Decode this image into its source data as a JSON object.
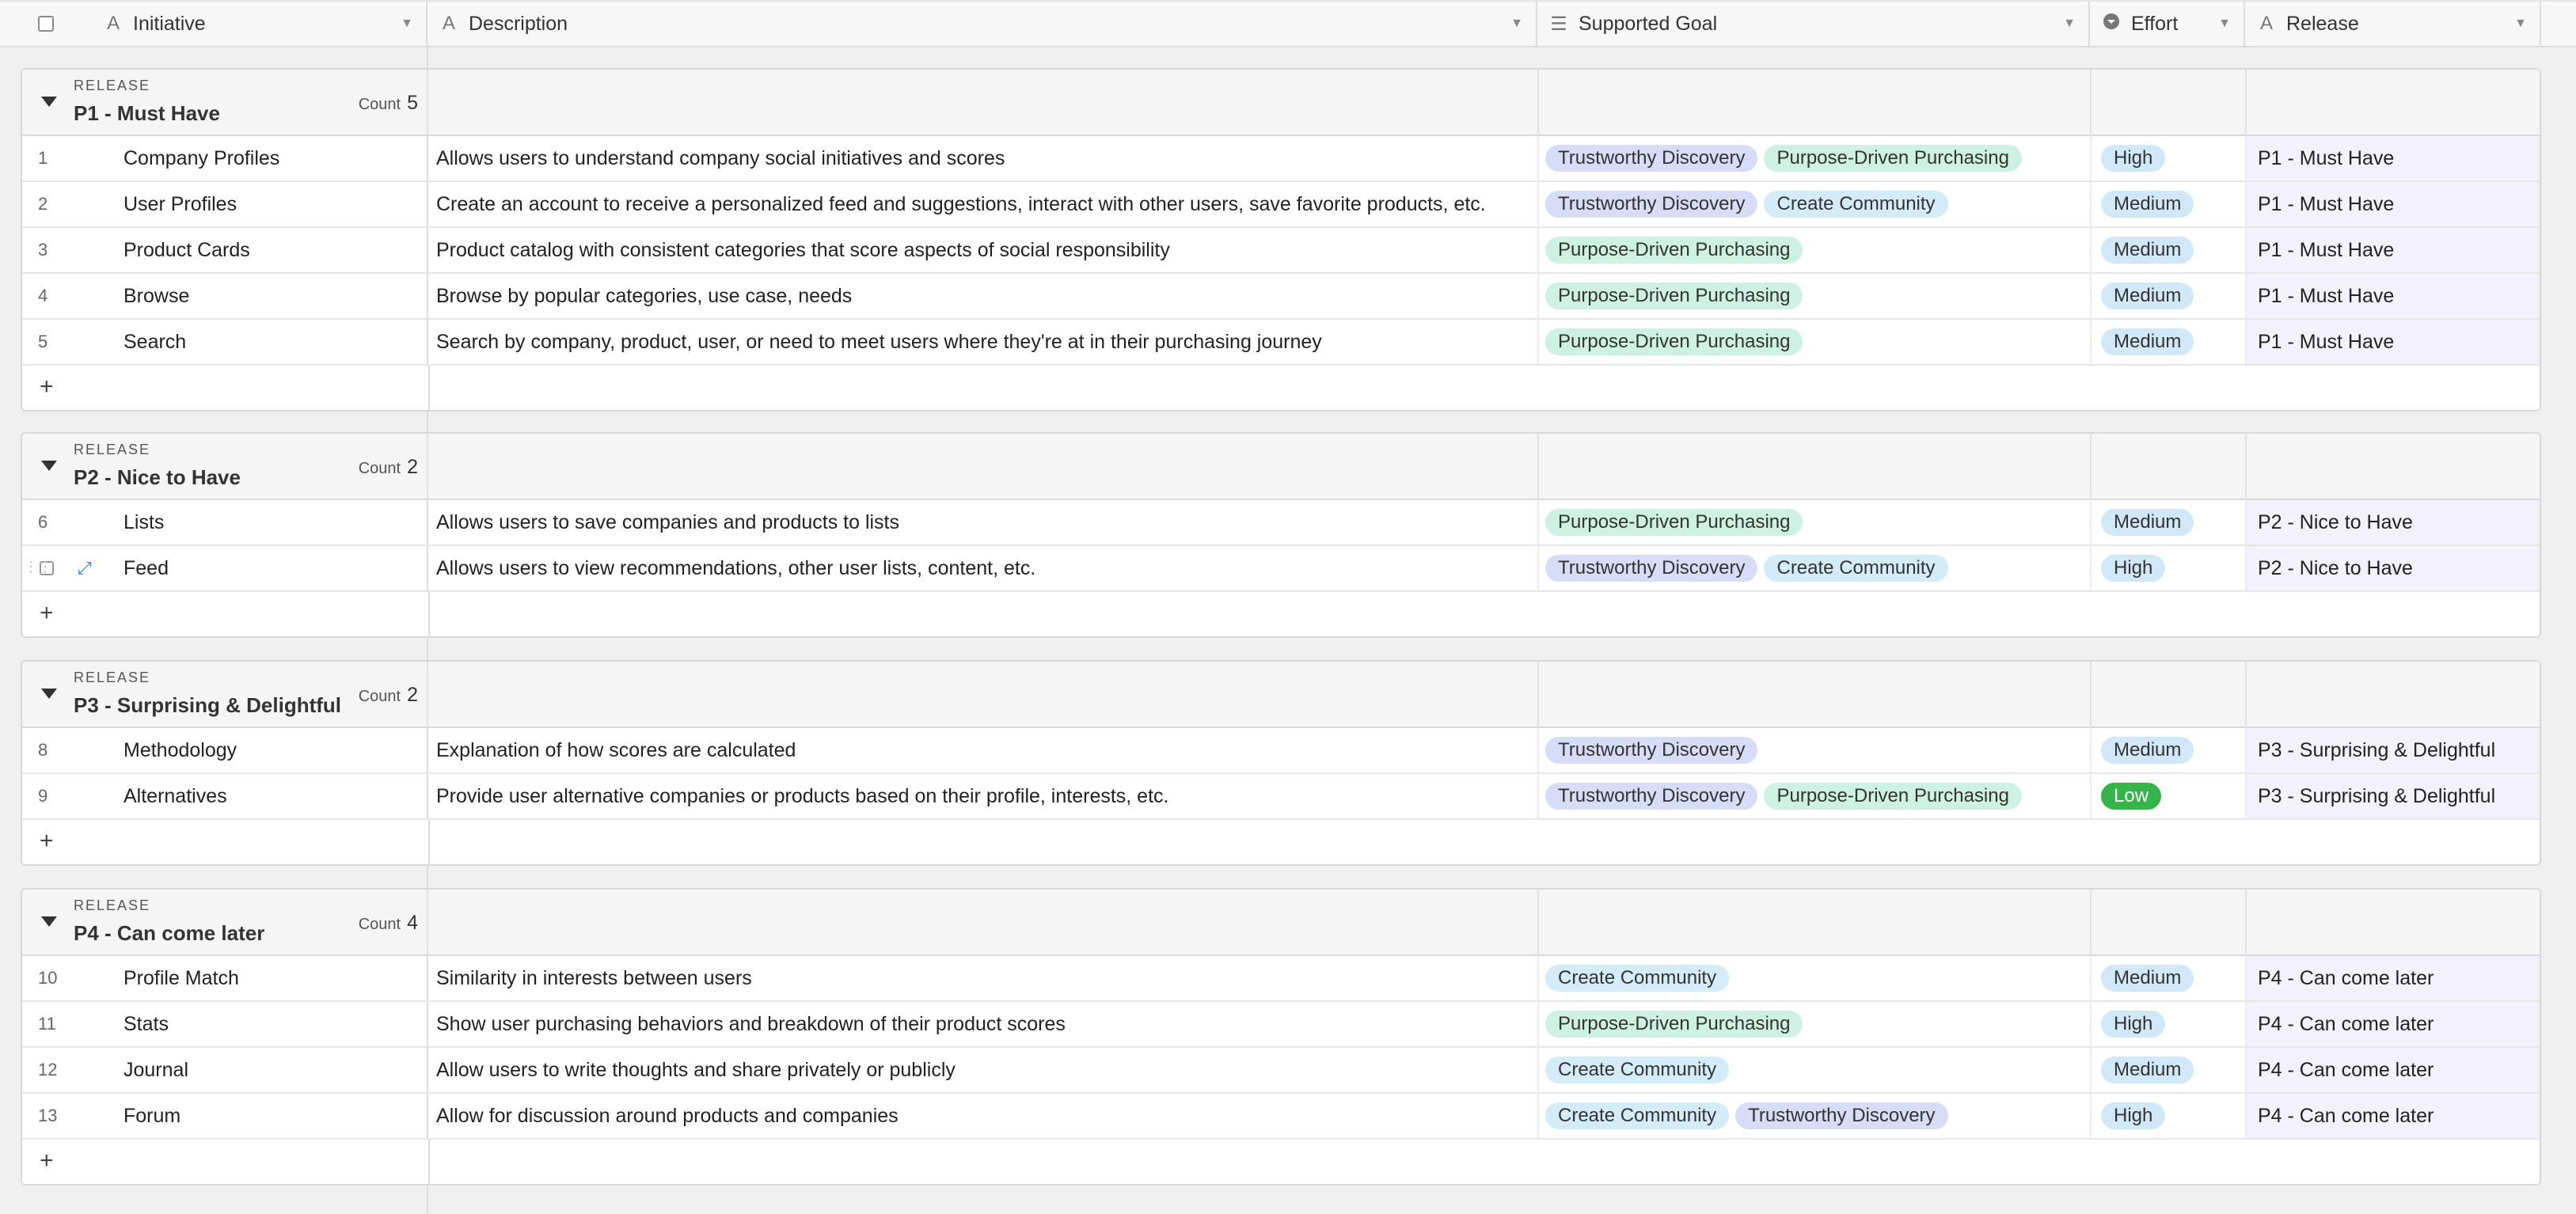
{
  "columns": {
    "initiative": {
      "label": "Initiative",
      "icon": "A"
    },
    "description": {
      "label": "Description",
      "icon": "A"
    },
    "goal": {
      "label": "Supported Goal",
      "icon": "☰"
    },
    "effort": {
      "label": "Effort",
      "icon": "▾"
    },
    "release": {
      "label": "Release",
      "icon": "A"
    }
  },
  "group_label": "RELEASE",
  "count_label": "Count",
  "add_label": "+",
  "groups": [
    {
      "title": "P1 - Must Have",
      "count": "5",
      "rows": [
        {
          "num": "1",
          "initiative": "Company Profiles",
          "description": "Allows users to understand company social initiatives and scores",
          "goals": [
            "Trustworthy Discovery",
            "Purpose-Driven Purchasing"
          ],
          "effort": "High",
          "release": "P1 - Must Have"
        },
        {
          "num": "2",
          "initiative": "User Profiles",
          "description": "Create an account to receive a personalized feed and suggestions, interact with other users, save favorite products, etc.",
          "goals": [
            "Trustworthy Discovery",
            "Create Community"
          ],
          "effort": "Medium",
          "release": "P1 - Must Have"
        },
        {
          "num": "3",
          "initiative": "Product Cards",
          "description": "Product catalog with consistent categories that score aspects of social responsibility",
          "goals": [
            "Purpose-Driven Purchasing"
          ],
          "effort": "Medium",
          "release": "P1 - Must Have"
        },
        {
          "num": "4",
          "initiative": "Browse",
          "description": "Browse by popular categories, use case, needs",
          "goals": [
            "Purpose-Driven Purchasing"
          ],
          "effort": "Medium",
          "release": "P1 - Must Have"
        },
        {
          "num": "5",
          "initiative": "Search",
          "description": "Search by company, product, user, or need to meet users where they're at in their purchasing journey",
          "goals": [
            "Purpose-Driven Purchasing"
          ],
          "effort": "Medium",
          "release": "P1 - Must Have"
        }
      ]
    },
    {
      "title": "P2 - Nice to Have",
      "count": "2",
      "rows": [
        {
          "num": "6",
          "initiative": "Lists",
          "description": "Allows users to save companies and products to lists",
          "goals": [
            "Purpose-Driven Purchasing"
          ],
          "effort": "Medium",
          "release": "P2 - Nice to Have"
        },
        {
          "num": "",
          "initiative": "Feed",
          "description": "Allows users to view recommendations, other user lists, content, etc.",
          "goals": [
            "Trustworthy Discovery",
            "Create Community"
          ],
          "effort": "High",
          "release": "P2 - Nice to Have",
          "hover": true
        }
      ]
    },
    {
      "title": "P3 - Surprising & Delightful",
      "count": "2",
      "rows": [
        {
          "num": "8",
          "initiative": "Methodology",
          "description": "Explanation of how scores are calculated",
          "goals": [
            "Trustworthy Discovery"
          ],
          "effort": "Medium",
          "release": "P3 - Surprising & Delightful"
        },
        {
          "num": "9",
          "initiative": "Alternatives",
          "description": "Provide user alternative companies or products based on their profile, interests, etc.",
          "goals": [
            "Trustworthy Discovery",
            "Purpose-Driven Purchasing"
          ],
          "effort": "Low",
          "release": "P3 - Surprising & Delightful"
        }
      ]
    },
    {
      "title": "P4 - Can come later",
      "count": "4",
      "rows": [
        {
          "num": "10",
          "initiative": "Profile Match",
          "description": "Similarity in interests between users",
          "goals": [
            "Create Community"
          ],
          "effort": "Medium",
          "release": "P4 - Can come later"
        },
        {
          "num": "11",
          "initiative": "Stats",
          "description": "Show user purchasing behaviors and breakdown of their product scores",
          "goals": [
            "Purpose-Driven Purchasing"
          ],
          "effort": "High",
          "release": "P4 - Can come later"
        },
        {
          "num": "12",
          "initiative": "Journal",
          "description": "Allow users to write thoughts and share privately or publicly",
          "goals": [
            "Create Community"
          ],
          "effort": "Medium",
          "release": "P4 - Can come later"
        },
        {
          "num": "13",
          "initiative": "Forum",
          "description": "Allow for discussion around products and companies",
          "goals": [
            "Create Community",
            "Trustworthy Discovery"
          ],
          "effort": "High",
          "release": "P4 - Can come later"
        }
      ]
    }
  ]
}
